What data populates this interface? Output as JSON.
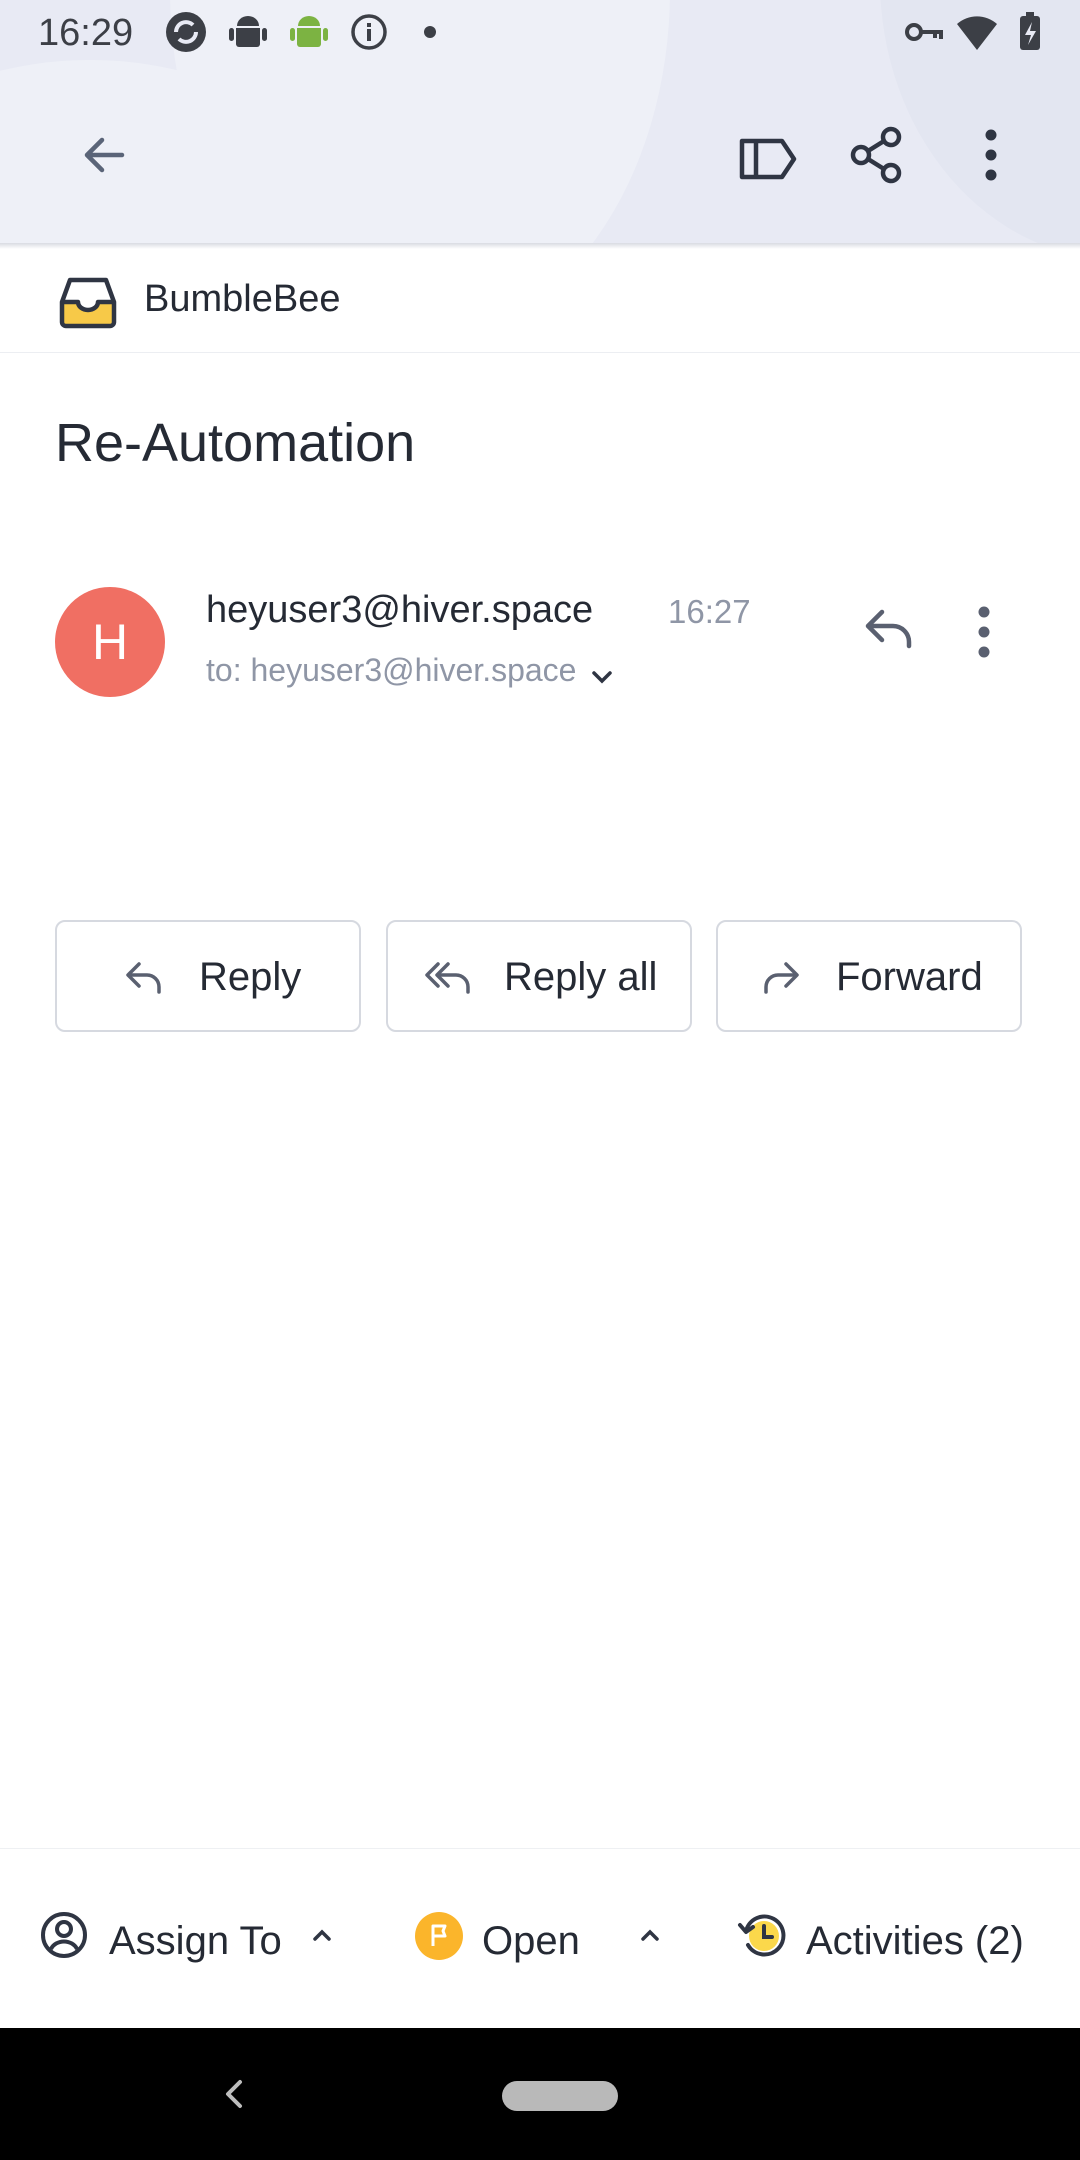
{
  "status_bar": {
    "time": "16:29",
    "icons": [
      "sync-icon",
      "android-icon",
      "android-green-icon",
      "info-icon",
      "dot-icon",
      "vpn-key-icon",
      "wifi-icon",
      "battery-charging-icon"
    ]
  },
  "toolbar": {
    "back_icon": "arrow-left-icon",
    "label_icon": "label-icon",
    "share_icon": "share-icon",
    "more_icon": "more-vertical-icon"
  },
  "mailbox": {
    "name": "BumbleBee",
    "icon": "inbox-tray-icon"
  },
  "email": {
    "subject": "Re-Automation",
    "avatar_letter": "H",
    "sender": "heyuser3@hiver.space",
    "time": "16:27",
    "to_line": "to: heyuser3@hiver.space"
  },
  "actions": {
    "reply": "Reply",
    "reply_all": "Reply all",
    "forward": "Forward"
  },
  "bottom_bar": {
    "assign_label": "Assign To",
    "status_label": "Open",
    "activities_label": "Activities (2)"
  },
  "colors": {
    "avatar": "#f06f63",
    "status_badge": "#fbb52b",
    "mailbox_icon": "#f7c948"
  }
}
